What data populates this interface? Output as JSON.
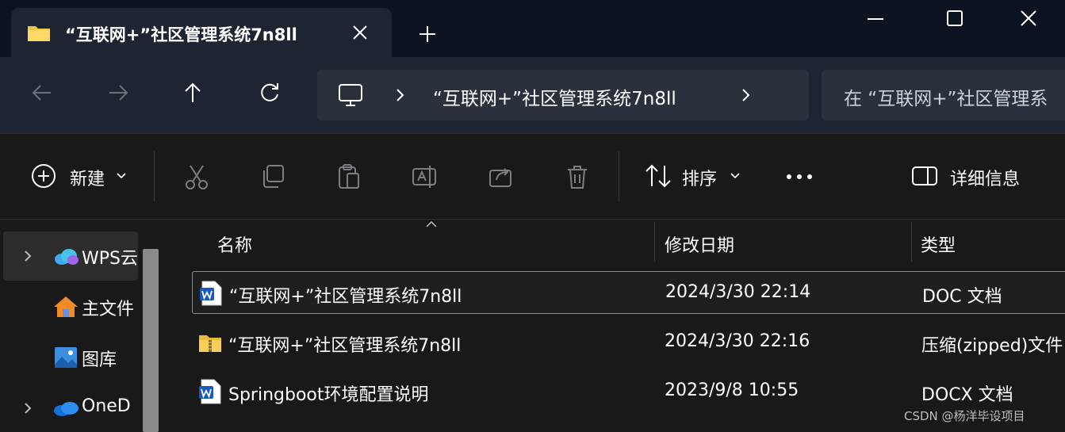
{
  "tab": {
    "title": "“互联网+”社区管理系统7n8ll",
    "folder_color": "#f4c542"
  },
  "address": {
    "crumb": "“互联网+”社区管理系统7n8ll",
    "search_placeholder": "在 “互联网+”社区管理系"
  },
  "toolbar": {
    "new_label": "新建",
    "sort_label": "排序",
    "details_label": "详细信息"
  },
  "sidebar": {
    "items": [
      {
        "label": "WPS云",
        "icon": "wps-cloud-icon"
      },
      {
        "label": "主文件",
        "icon": "home-icon"
      },
      {
        "label": "图库",
        "icon": "gallery-icon"
      },
      {
        "label": "OneD",
        "icon": "onedrive-icon"
      }
    ]
  },
  "columns": {
    "name": "名称",
    "modified": "修改日期",
    "type": "类型"
  },
  "files": [
    {
      "name": "“互联网+”社区管理系统7n8ll",
      "modified": "2024/3/30 22:14",
      "type": "DOC 文档",
      "icon": "word-doc-icon"
    },
    {
      "name": "“互联网+”社区管理系统7n8ll",
      "modified": "2024/3/30 22:16",
      "type": "压缩(zipped)文件",
      "icon": "zip-folder-icon"
    },
    {
      "name": "Springboot环境配置说明",
      "modified": "2023/9/8 10:55",
      "type": "DOCX 文档",
      "icon": "word-doc-icon"
    }
  ],
  "watermark": "CSDN @杨洋毕设项目",
  "colors": {
    "accent_word": "#185abd",
    "zip_yellow": "#e8b93a"
  }
}
